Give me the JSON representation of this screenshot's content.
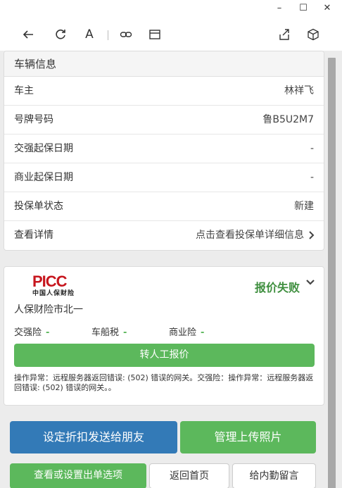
{
  "window": {
    "minimize": "–",
    "maximize": "☐",
    "close": "✕"
  },
  "toolbar": {
    "font_label": "A"
  },
  "vehicle": {
    "title": "车辆信息",
    "rows": [
      {
        "label": "车主",
        "value": "林祥飞"
      },
      {
        "label": "号牌号码",
        "value": "鲁B5U2M7"
      },
      {
        "label": "交强起保日期",
        "value": "-"
      },
      {
        "label": "商业起保日期",
        "value": "-"
      },
      {
        "label": "投保单状态",
        "value": "新建"
      },
      {
        "label": "查看详情",
        "value": "点击查看投保单详细信息"
      }
    ]
  },
  "quote": {
    "logo_text": "PICC",
    "logo_sub": "中国人保财险",
    "company": "人保财险市北一",
    "status": "报价失败",
    "jq_label": "交强险",
    "jq_value": "-",
    "cc_label": "车船税",
    "cc_value": "-",
    "sy_label": "商业险",
    "sy_value": "-",
    "manual_button": "转人工报价",
    "error": "操作异常：远程服务器返回错误: (502) 错误的网关。交强险：操作异常：远程服务器返回错误: (502) 错误的网关。。"
  },
  "actions": {
    "share_discount": "设定折扣发送给朋友",
    "manage_photos": "管理上传照片",
    "view_options": "查看或设置出单选项",
    "back_home": "返回首页",
    "leave_message": "给内勤留言"
  },
  "colors": {
    "primary_blue": "#337ab7",
    "success_green": "#5cb85c",
    "status_green": "#3f8f3f",
    "picc_red": "#c7161e"
  }
}
